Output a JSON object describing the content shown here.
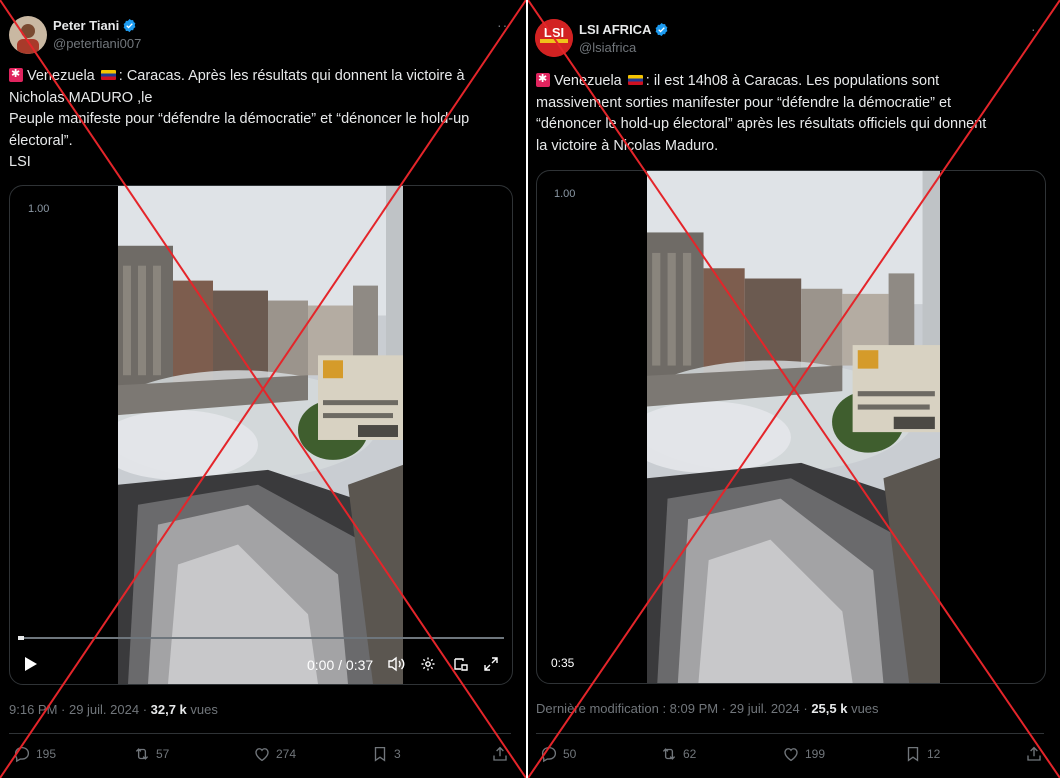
{
  "left": {
    "author": {
      "name": "Peter Tiani",
      "handle": "@petertiani007"
    },
    "text_lines": [
      ": Caracas. Après les résultats qui donnent la victoire à",
      "Nicholas MADURO ,le",
      "Peuple manifeste pour “défendre la démocratie” et “dénoncer le hold-up",
      "électoral”.",
      "LSI"
    ],
    "country": "Venezuela",
    "video": {
      "speed": "1.00",
      "time": "0:00 / 0:37",
      "progress_fraction": 0.0
    },
    "meta": {
      "time_date": "9:16 PM · 29 juil. 2024 · ",
      "views_count": "32,7 k",
      "views_label": " vues"
    },
    "actions": {
      "replies": "195",
      "reposts": "57",
      "likes": "274",
      "bookmarks": "3"
    }
  },
  "right": {
    "author": {
      "name": "LSI AFRICA",
      "handle": "@lsiafrica",
      "avatar_text": "LSI"
    },
    "text_first": ": il est 14h08 à Caracas. Les populations sont",
    "text_lines": [
      "massivement sorties manifester pour “défendre la démocratie” et",
      "“dénoncer le hold-up électoral” après les résultats officiels qui donnent",
      "la victoire à Nicolas Maduro."
    ],
    "country": "Venezuela",
    "video": {
      "speed": "1.00",
      "duration": "0:35"
    },
    "meta": {
      "time_date": "Dernière modification : 8:09 PM · 29 juil. 2024 · ",
      "views_count": "25,5 k",
      "views_label": " vues"
    },
    "actions": {
      "replies": "50",
      "reposts": "62",
      "likes": "199",
      "bookmarks": "12"
    }
  },
  "colors": {
    "cross": "#e4252a",
    "accent": "#1d9bf0",
    "background": "#000000"
  }
}
